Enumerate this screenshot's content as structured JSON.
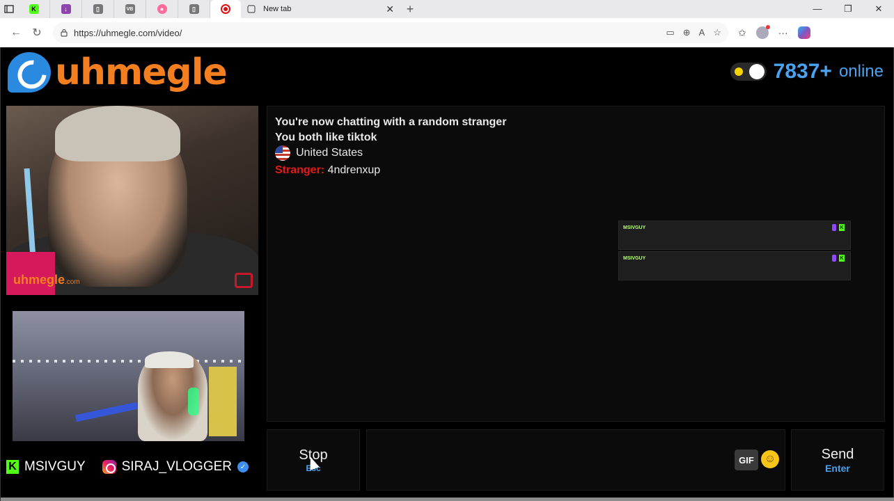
{
  "browser": {
    "tabs": [
      {
        "icon": "kick-icon",
        "color": "#53fc18",
        "glyph": "K"
      },
      {
        "icon": "twitch-download-icon",
        "color": "#8e44ad",
        "glyph": "↓"
      },
      {
        "icon": "document-icon",
        "color": "#777777",
        "glyph": "▯"
      },
      {
        "icon": "vb-icon",
        "color": "#777777",
        "glyph": "VB"
      },
      {
        "icon": "gradient-icon",
        "color": "#ff6b9a",
        "glyph": "●"
      },
      {
        "icon": "document-icon",
        "color": "#777777",
        "glyph": "▯"
      }
    ],
    "new_tab_label": "New tab",
    "url": "https://uhmegle.com/video/"
  },
  "site": {
    "logo_text": "uhmegle",
    "online_count": "7837+",
    "online_label": "online",
    "watermark_brand": "uhmegle",
    "watermark_suffix": ".com"
  },
  "chat": {
    "line1": "You're now chatting with a random stranger",
    "line2": "You both like tiktok",
    "country": "United States",
    "stranger_label": "Stranger:",
    "stranger_message": "4ndrenxup"
  },
  "overlay": {
    "cards": [
      {
        "name": "MSIVGUY"
      },
      {
        "name": "MSIVGUY"
      }
    ]
  },
  "socials": {
    "kick_handle": "MSIVGUY",
    "instagram_handle": "SIRAJ_VLOGGER"
  },
  "controls": {
    "stop_label": "Stop",
    "stop_hint": "Esc",
    "gif_label": "GIF",
    "send_label": "Send",
    "send_hint": "Enter"
  },
  "colors": {
    "brand_orange": "#f47f20",
    "brand_blue": "#4aa3f0",
    "stranger_red": "#e01b1b",
    "kick_green": "#53fc18"
  }
}
